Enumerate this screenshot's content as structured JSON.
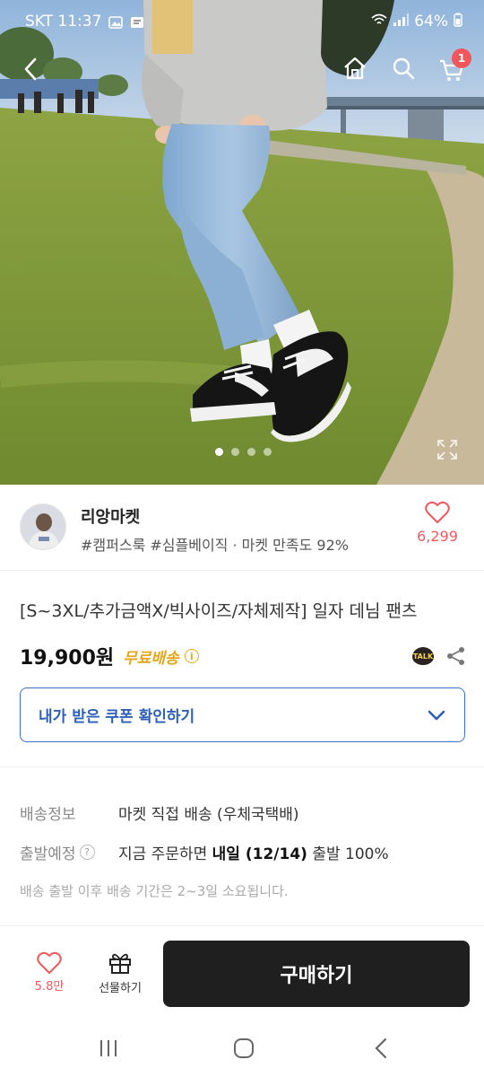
{
  "status_bar": {
    "carrier_time": "SKT 11:37",
    "battery": "64%"
  },
  "top_nav": {
    "back_icon": "chevron-left-icon",
    "home_icon": "home-icon",
    "search_icon": "search-icon",
    "cart_icon": "cart-icon",
    "cart_badge": "1"
  },
  "carousel": {
    "slide_count": 4,
    "active_index": 0
  },
  "shop": {
    "name": "리앙마켓",
    "meta": "#캠퍼스룩 #심플베이직 · 마켓 만족도 92%",
    "like_count": "6,299"
  },
  "product": {
    "title": "[S~3XL/추가금액X/빅사이즈/자체제작] 일자 데님 팬츠",
    "price": "19,900원",
    "free_shipping": "무료배송",
    "info_mark": "i",
    "talk_label": "TALK"
  },
  "coupon": {
    "label": "내가 받은 쿠폰 확인하기"
  },
  "shipping": {
    "method_key": "배송정보",
    "method_value": "마켓 직접 배송 (우체국택배)",
    "dispatch_key": "출발예정",
    "dispatch_help": "?",
    "dispatch_prefix": "지금 주문하면 ",
    "dispatch_date": "내일 (12/14)",
    "dispatch_suffix": " 출발 100%",
    "note": "배송 출발 이후 배송 기간은 2~3일 소요됩니다."
  },
  "bottom_bar": {
    "like_count": "5.8만",
    "gift_label": "선물하기",
    "buy_label": "구매하기"
  },
  "colors": {
    "accent_red": "#ef5a5f",
    "free_ship_orange": "#e6a619",
    "coupon_blue": "#2e5fb8",
    "buy_button": "#1f1f1f"
  }
}
